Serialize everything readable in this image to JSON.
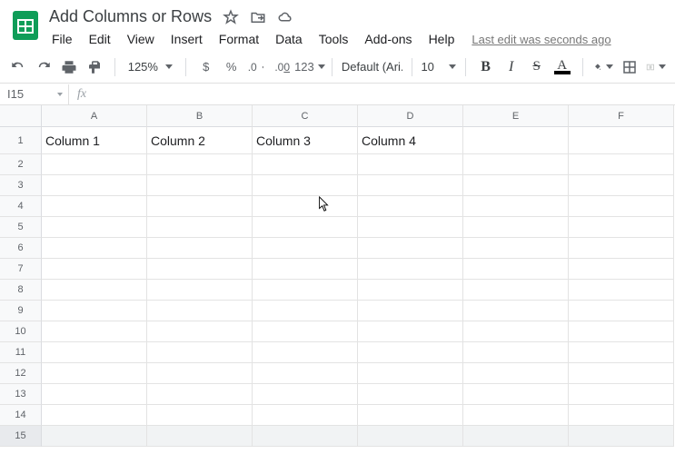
{
  "doc": {
    "title": "Add Columns or Rows"
  },
  "menus": {
    "file": "File",
    "edit": "Edit",
    "view": "View",
    "insert": "Insert",
    "format": "Format",
    "data": "Data",
    "tools": "Tools",
    "addons": "Add-ons",
    "help": "Help",
    "last_edit": "Last edit was seconds ago"
  },
  "toolbar": {
    "zoom": "125%",
    "currency": "$",
    "percent": "%",
    "dec_less": ".0",
    "dec_more": ".00",
    "num_format": "123",
    "font": "Default (Ari...",
    "font_size": "10"
  },
  "namebox": {
    "ref": "I15",
    "fx": "fx",
    "formula": ""
  },
  "columns": [
    "A",
    "B",
    "C",
    "D",
    "E",
    "F"
  ],
  "rows": [
    "1",
    "2",
    "3",
    "4",
    "5",
    "6",
    "7",
    "8",
    "9",
    "10",
    "11",
    "12",
    "13",
    "14",
    "15"
  ],
  "cells": {
    "r1": {
      "A": "Column 1",
      "B": "Column 2",
      "C": "Column 3",
      "D": "Column 4"
    }
  },
  "selected_row": 15
}
